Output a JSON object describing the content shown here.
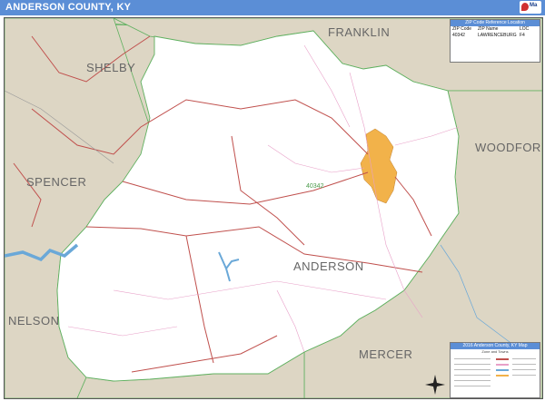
{
  "header": {
    "title": "ANDERSON COUNTY, KY",
    "brand_color": "#5b8ed6"
  },
  "map": {
    "colors": {
      "outside_county": "#ddd6c4",
      "county_fill": "#ffffff",
      "city_fill": "#f2b24a",
      "water": "#6aa8d8",
      "major_road": "#c0504d",
      "minor_road": "#e8a0c8",
      "boundary": "#5fb05f"
    },
    "county_labels": {
      "franklin": "FRANKLIN",
      "shelby": "SHELBY",
      "woodford": "WOODFORD",
      "spencer": "SPENCER",
      "anderson": "ANDERSON",
      "nelson": "NELSON",
      "mercer": "MERCER"
    },
    "road_label": "40342"
  },
  "zip_table": {
    "title": "ZIP Code Reference Location",
    "headers": [
      "ZIP Code",
      "ZIP Name",
      "LOC"
    ],
    "rows": [
      {
        "zip": "40342",
        "name": "LAWRENCEBURG",
        "loc": "F4"
      }
    ]
  },
  "legend": {
    "title": "2016 Anderson County, KY Map",
    "subtitle": "Zone and Towns",
    "icons": [
      "compass-icon",
      "scale-bar"
    ]
  }
}
